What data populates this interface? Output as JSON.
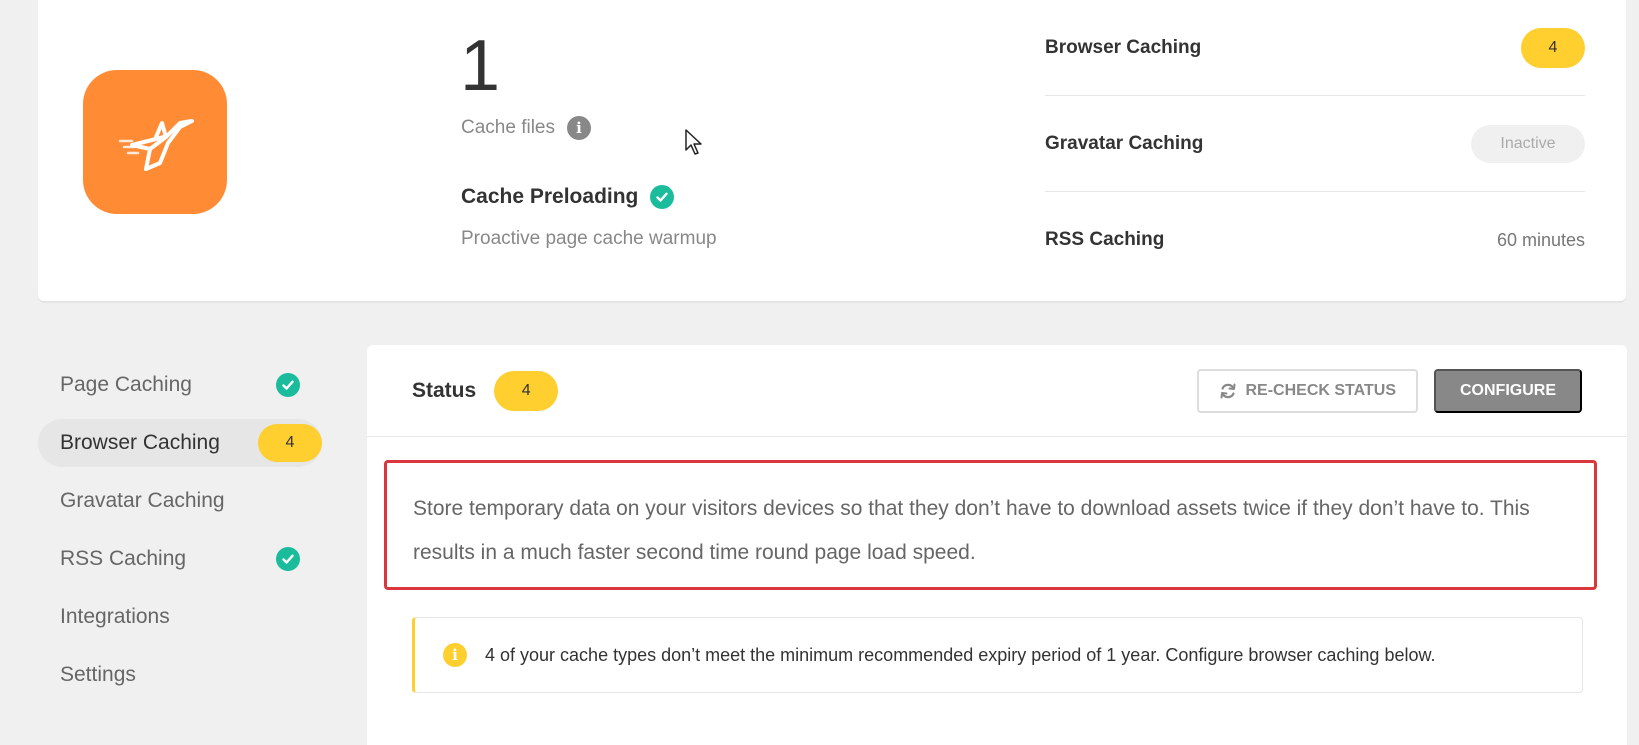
{
  "summary": {
    "cache_count": "1",
    "cache_files_label": "Cache files",
    "preloading_title": "Cache Preloading",
    "preloading_desc": "Proactive page cache warmup",
    "stats": [
      {
        "label": "Browser Caching",
        "value": "4",
        "kind": "warning-badge"
      },
      {
        "label": "Gravatar Caching",
        "value": "Inactive",
        "kind": "inactive-badge"
      },
      {
        "label": "RSS Caching",
        "value": "60 minutes",
        "kind": "text"
      }
    ]
  },
  "sidebar": {
    "items": [
      {
        "label": "Page Caching",
        "status": "check"
      },
      {
        "label": "Browser Caching",
        "status": "badge",
        "badge": "4",
        "active": true
      },
      {
        "label": "Gravatar Caching"
      },
      {
        "label": "RSS Caching",
        "status": "check"
      },
      {
        "label": "Integrations"
      },
      {
        "label": "Settings"
      }
    ]
  },
  "main": {
    "status_title": "Status",
    "status_count": "4",
    "recheck_label": "RE-CHECK STATUS",
    "configure_label": "CONFIGURE",
    "description": "Store temporary data on your visitors devices so that they don’t have to download assets twice if they don’t have to. This results in a much faster second time round page load speed.",
    "notice": "4 of your cache types don’t meet the minimum recommended expiry period of 1 year. Configure browser caching below."
  },
  "colors": {
    "brand": "#ff8c35",
    "warning": "#fecf2f",
    "success": "#1abc9c",
    "highlight": "#d9363e"
  }
}
